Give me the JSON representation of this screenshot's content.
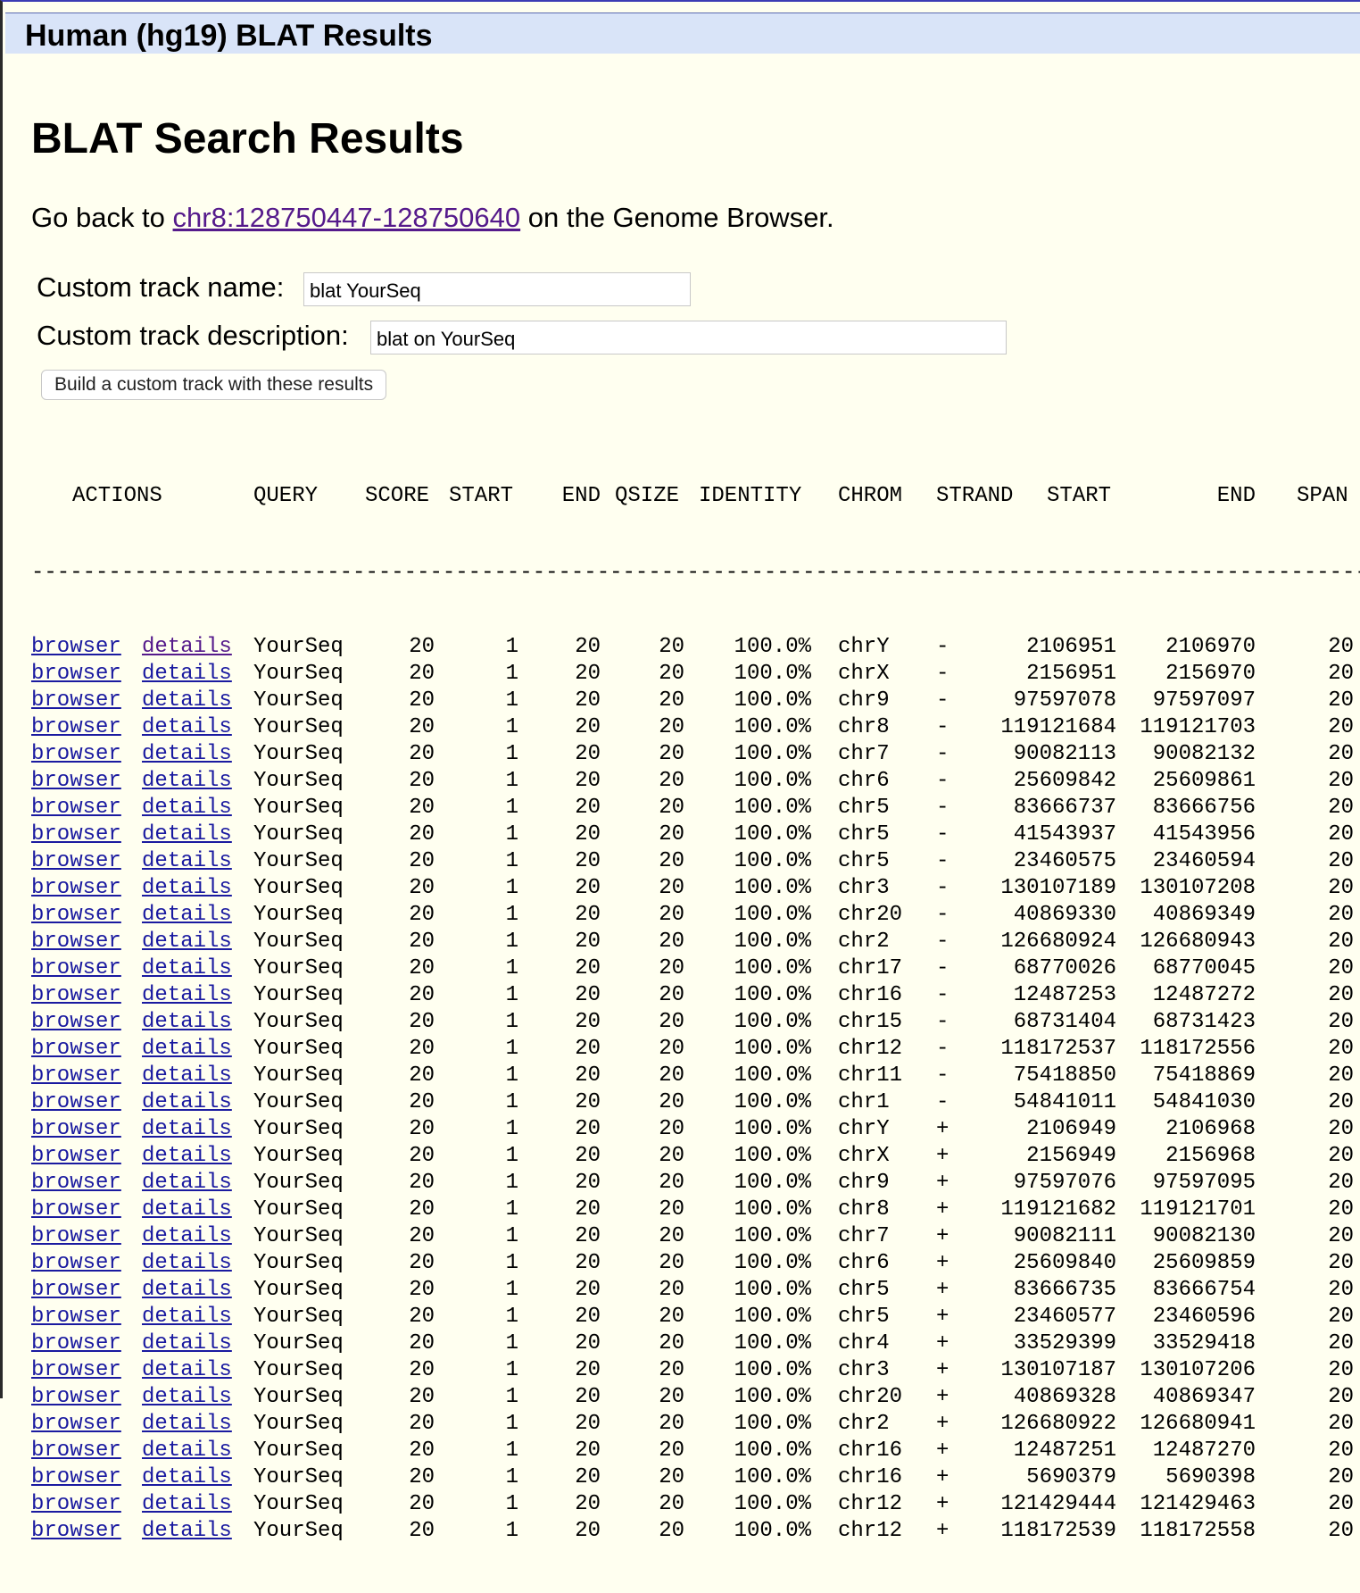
{
  "titlebar": {
    "text": "Human (hg19) BLAT Results"
  },
  "page": {
    "title": "BLAT Search Results"
  },
  "goback": {
    "prefix": "Go back to",
    "link": "chr8:128750447-128750640",
    "suffix": "on the Genome Browser."
  },
  "form": {
    "name_label": "Custom track name:",
    "name_value": "blat YourSeq",
    "desc_label": "Custom track description:",
    "desc_value": "blat on YourSeq",
    "build_button": "Build a custom track with these results"
  },
  "table": {
    "headers": {
      "actions": "ACTIONS",
      "query": "QUERY",
      "score": "SCORE",
      "qstart": "START",
      "qend": "END",
      "qsize": "QSIZE",
      "identity": "IDENTITY",
      "chrom": "CHROM",
      "strand": "STRAND",
      "start": "START",
      "end": "END",
      "span": "SPAN"
    },
    "separator": "-------------------------------------------------------------------------------------------------------------------------------",
    "browser_label": "browser",
    "details_label": "details",
    "rows": [
      {
        "query": "YourSeq",
        "score": "20",
        "qstart": "1",
        "qend": "20",
        "qsize": "20",
        "identity": "100.0%",
        "chrom": "chrY",
        "strand": "-",
        "start": "2106951",
        "end": "2106970",
        "span": "20"
      },
      {
        "query": "YourSeq",
        "score": "20",
        "qstart": "1",
        "qend": "20",
        "qsize": "20",
        "identity": "100.0%",
        "chrom": "chrX",
        "strand": "-",
        "start": "2156951",
        "end": "2156970",
        "span": "20"
      },
      {
        "query": "YourSeq",
        "score": "20",
        "qstart": "1",
        "qend": "20",
        "qsize": "20",
        "identity": "100.0%",
        "chrom": "chr9",
        "strand": "-",
        "start": "97597078",
        "end": "97597097",
        "span": "20"
      },
      {
        "query": "YourSeq",
        "score": "20",
        "qstart": "1",
        "qend": "20",
        "qsize": "20",
        "identity": "100.0%",
        "chrom": "chr8",
        "strand": "-",
        "start": "119121684",
        "end": "119121703",
        "span": "20"
      },
      {
        "query": "YourSeq",
        "score": "20",
        "qstart": "1",
        "qend": "20",
        "qsize": "20",
        "identity": "100.0%",
        "chrom": "chr7",
        "strand": "-",
        "start": "90082113",
        "end": "90082132",
        "span": "20"
      },
      {
        "query": "YourSeq",
        "score": "20",
        "qstart": "1",
        "qend": "20",
        "qsize": "20",
        "identity": "100.0%",
        "chrom": "chr6",
        "strand": "-",
        "start": "25609842",
        "end": "25609861",
        "span": "20"
      },
      {
        "query": "YourSeq",
        "score": "20",
        "qstart": "1",
        "qend": "20",
        "qsize": "20",
        "identity": "100.0%",
        "chrom": "chr5",
        "strand": "-",
        "start": "83666737",
        "end": "83666756",
        "span": "20"
      },
      {
        "query": "YourSeq",
        "score": "20",
        "qstart": "1",
        "qend": "20",
        "qsize": "20",
        "identity": "100.0%",
        "chrom": "chr5",
        "strand": "-",
        "start": "41543937",
        "end": "41543956",
        "span": "20"
      },
      {
        "query": "YourSeq",
        "score": "20",
        "qstart": "1",
        "qend": "20",
        "qsize": "20",
        "identity": "100.0%",
        "chrom": "chr5",
        "strand": "-",
        "start": "23460575",
        "end": "23460594",
        "span": "20"
      },
      {
        "query": "YourSeq",
        "score": "20",
        "qstart": "1",
        "qend": "20",
        "qsize": "20",
        "identity": "100.0%",
        "chrom": "chr3",
        "strand": "-",
        "start": "130107189",
        "end": "130107208",
        "span": "20"
      },
      {
        "query": "YourSeq",
        "score": "20",
        "qstart": "1",
        "qend": "20",
        "qsize": "20",
        "identity": "100.0%",
        "chrom": "chr20",
        "strand": "-",
        "start": "40869330",
        "end": "40869349",
        "span": "20"
      },
      {
        "query": "YourSeq",
        "score": "20",
        "qstart": "1",
        "qend": "20",
        "qsize": "20",
        "identity": "100.0%",
        "chrom": "chr2",
        "strand": "-",
        "start": "126680924",
        "end": "126680943",
        "span": "20"
      },
      {
        "query": "YourSeq",
        "score": "20",
        "qstart": "1",
        "qend": "20",
        "qsize": "20",
        "identity": "100.0%",
        "chrom": "chr17",
        "strand": "-",
        "start": "68770026",
        "end": "68770045",
        "span": "20"
      },
      {
        "query": "YourSeq",
        "score": "20",
        "qstart": "1",
        "qend": "20",
        "qsize": "20",
        "identity": "100.0%",
        "chrom": "chr16",
        "strand": "-",
        "start": "12487253",
        "end": "12487272",
        "span": "20"
      },
      {
        "query": "YourSeq",
        "score": "20",
        "qstart": "1",
        "qend": "20",
        "qsize": "20",
        "identity": "100.0%",
        "chrom": "chr15",
        "strand": "-",
        "start": "68731404",
        "end": "68731423",
        "span": "20"
      },
      {
        "query": "YourSeq",
        "score": "20",
        "qstart": "1",
        "qend": "20",
        "qsize": "20",
        "identity": "100.0%",
        "chrom": "chr12",
        "strand": "-",
        "start": "118172537",
        "end": "118172556",
        "span": "20"
      },
      {
        "query": "YourSeq",
        "score": "20",
        "qstart": "1",
        "qend": "20",
        "qsize": "20",
        "identity": "100.0%",
        "chrom": "chr11",
        "strand": "-",
        "start": "75418850",
        "end": "75418869",
        "span": "20"
      },
      {
        "query": "YourSeq",
        "score": "20",
        "qstart": "1",
        "qend": "20",
        "qsize": "20",
        "identity": "100.0%",
        "chrom": "chr1",
        "strand": "-",
        "start": "54841011",
        "end": "54841030",
        "span": "20"
      },
      {
        "query": "YourSeq",
        "score": "20",
        "qstart": "1",
        "qend": "20",
        "qsize": "20",
        "identity": "100.0%",
        "chrom": "chrY",
        "strand": "+",
        "start": "2106949",
        "end": "2106968",
        "span": "20"
      },
      {
        "query": "YourSeq",
        "score": "20",
        "qstart": "1",
        "qend": "20",
        "qsize": "20",
        "identity": "100.0%",
        "chrom": "chrX",
        "strand": "+",
        "start": "2156949",
        "end": "2156968",
        "span": "20"
      },
      {
        "query": "YourSeq",
        "score": "20",
        "qstart": "1",
        "qend": "20",
        "qsize": "20",
        "identity": "100.0%",
        "chrom": "chr9",
        "strand": "+",
        "start": "97597076",
        "end": "97597095",
        "span": "20"
      },
      {
        "query": "YourSeq",
        "score": "20",
        "qstart": "1",
        "qend": "20",
        "qsize": "20",
        "identity": "100.0%",
        "chrom": "chr8",
        "strand": "+",
        "start": "119121682",
        "end": "119121701",
        "span": "20"
      },
      {
        "query": "YourSeq",
        "score": "20",
        "qstart": "1",
        "qend": "20",
        "qsize": "20",
        "identity": "100.0%",
        "chrom": "chr7",
        "strand": "+",
        "start": "90082111",
        "end": "90082130",
        "span": "20"
      },
      {
        "query": "YourSeq",
        "score": "20",
        "qstart": "1",
        "qend": "20",
        "qsize": "20",
        "identity": "100.0%",
        "chrom": "chr6",
        "strand": "+",
        "start": "25609840",
        "end": "25609859",
        "span": "20"
      },
      {
        "query": "YourSeq",
        "score": "20",
        "qstart": "1",
        "qend": "20",
        "qsize": "20",
        "identity": "100.0%",
        "chrom": "chr5",
        "strand": "+",
        "start": "83666735",
        "end": "83666754",
        "span": "20"
      },
      {
        "query": "YourSeq",
        "score": "20",
        "qstart": "1",
        "qend": "20",
        "qsize": "20",
        "identity": "100.0%",
        "chrom": "chr5",
        "strand": "+",
        "start": "23460577",
        "end": "23460596",
        "span": "20"
      },
      {
        "query": "YourSeq",
        "score": "20",
        "qstart": "1",
        "qend": "20",
        "qsize": "20",
        "identity": "100.0%",
        "chrom": "chr4",
        "strand": "+",
        "start": "33529399",
        "end": "33529418",
        "span": "20"
      },
      {
        "query": "YourSeq",
        "score": "20",
        "qstart": "1",
        "qend": "20",
        "qsize": "20",
        "identity": "100.0%",
        "chrom": "chr3",
        "strand": "+",
        "start": "130107187",
        "end": "130107206",
        "span": "20"
      },
      {
        "query": "YourSeq",
        "score": "20",
        "qstart": "1",
        "qend": "20",
        "qsize": "20",
        "identity": "100.0%",
        "chrom": "chr20",
        "strand": "+",
        "start": "40869328",
        "end": "40869347",
        "span": "20"
      },
      {
        "query": "YourSeq",
        "score": "20",
        "qstart": "1",
        "qend": "20",
        "qsize": "20",
        "identity": "100.0%",
        "chrom": "chr2",
        "strand": "+",
        "start": "126680922",
        "end": "126680941",
        "span": "20"
      },
      {
        "query": "YourSeq",
        "score": "20",
        "qstart": "1",
        "qend": "20",
        "qsize": "20",
        "identity": "100.0%",
        "chrom": "chr16",
        "strand": "+",
        "start": "12487251",
        "end": "12487270",
        "span": "20"
      },
      {
        "query": "YourSeq",
        "score": "20",
        "qstart": "1",
        "qend": "20",
        "qsize": "20",
        "identity": "100.0%",
        "chrom": "chr16",
        "strand": "+",
        "start": "5690379",
        "end": "5690398",
        "span": "20"
      },
      {
        "query": "YourSeq",
        "score": "20",
        "qstart": "1",
        "qend": "20",
        "qsize": "20",
        "identity": "100.0%",
        "chrom": "chr12",
        "strand": "+",
        "start": "121429444",
        "end": "121429463",
        "span": "20"
      },
      {
        "query": "YourSeq",
        "score": "20",
        "qstart": "1",
        "qend": "20",
        "qsize": "20",
        "identity": "100.0%",
        "chrom": "chr12",
        "strand": "+",
        "start": "118172539",
        "end": "118172558",
        "span": "20"
      }
    ]
  }
}
